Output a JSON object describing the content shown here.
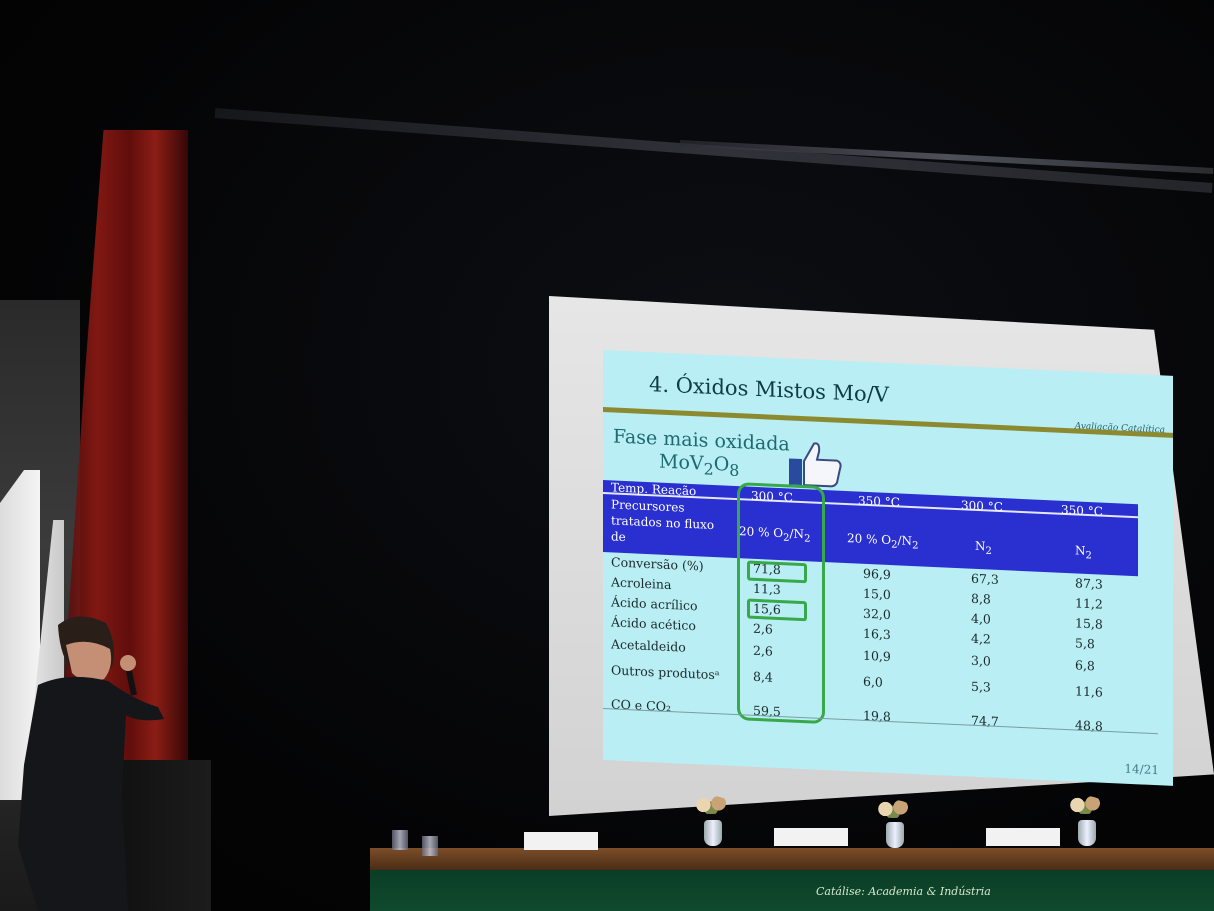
{
  "slide": {
    "title": "4. Óxidos Mistos Mo/V",
    "section_tag": "Avaliação Catalítica",
    "subtitle_line1": "Fase mais oxidada",
    "formula_base": "MoV",
    "formula_sub1": "2",
    "formula_o": "O",
    "formula_sub2": "8",
    "page_number": "14/21",
    "table": {
      "header_label": "Temp. Reação",
      "temps": [
        "300 °C",
        "350 °C",
        "300 °C",
        "350 °C"
      ],
      "precursor_label": [
        "Precursores",
        "tratados no fluxo",
        "de"
      ],
      "atmospheres": [
        {
          "base": "20 % O",
          "sub": "2",
          "tail": "/N",
          "sub2": "2"
        },
        {
          "base": "20 % O",
          "sub": "2",
          "tail": "/N",
          "sub2": "2"
        },
        {
          "base": "N",
          "sub": "2",
          "tail": "",
          "sub2": ""
        },
        {
          "base": "N",
          "sub": "2",
          "tail": "",
          "sub2": ""
        }
      ],
      "rows": [
        {
          "label": "Conversão (%)",
          "values": [
            "71,8",
            "96,9",
            "67,3",
            "87,3"
          ]
        },
        {
          "label": "Acroleina",
          "values": [
            "11,3",
            "15,0",
            "8,8",
            "11,2"
          ]
        },
        {
          "label": "Ácido acrílico",
          "values": [
            "15,6",
            "32,0",
            "4,0",
            "15,8"
          ]
        },
        {
          "label": "Ácido acético",
          "values": [
            "2,6",
            "16,3",
            "4,2",
            "5,8"
          ]
        },
        {
          "label": "Acetaldeido",
          "values": [
            "2,6",
            "10,9",
            "3,0",
            "6,8"
          ]
        },
        {
          "label": "Outros produtosᵃ",
          "values": [
            "8,4",
            "6,0",
            "5,3",
            "11,6"
          ]
        },
        {
          "label": "CO e CO₂",
          "values": [
            "59,5",
            "19,8",
            "74,7",
            "48,8"
          ]
        }
      ]
    }
  },
  "banner": {
    "text": "Catálise: Academia & Indústria"
  },
  "colors": {
    "slide_bg": "#b8eef4",
    "header_blue": "#2a2fd0",
    "highlight_green": "#38a84a",
    "title_rule": "#8c8a30",
    "curtain_red": "#8e1a14",
    "table_green": "#0f4a2e"
  },
  "icons": [
    "thumbs-up-icon"
  ]
}
